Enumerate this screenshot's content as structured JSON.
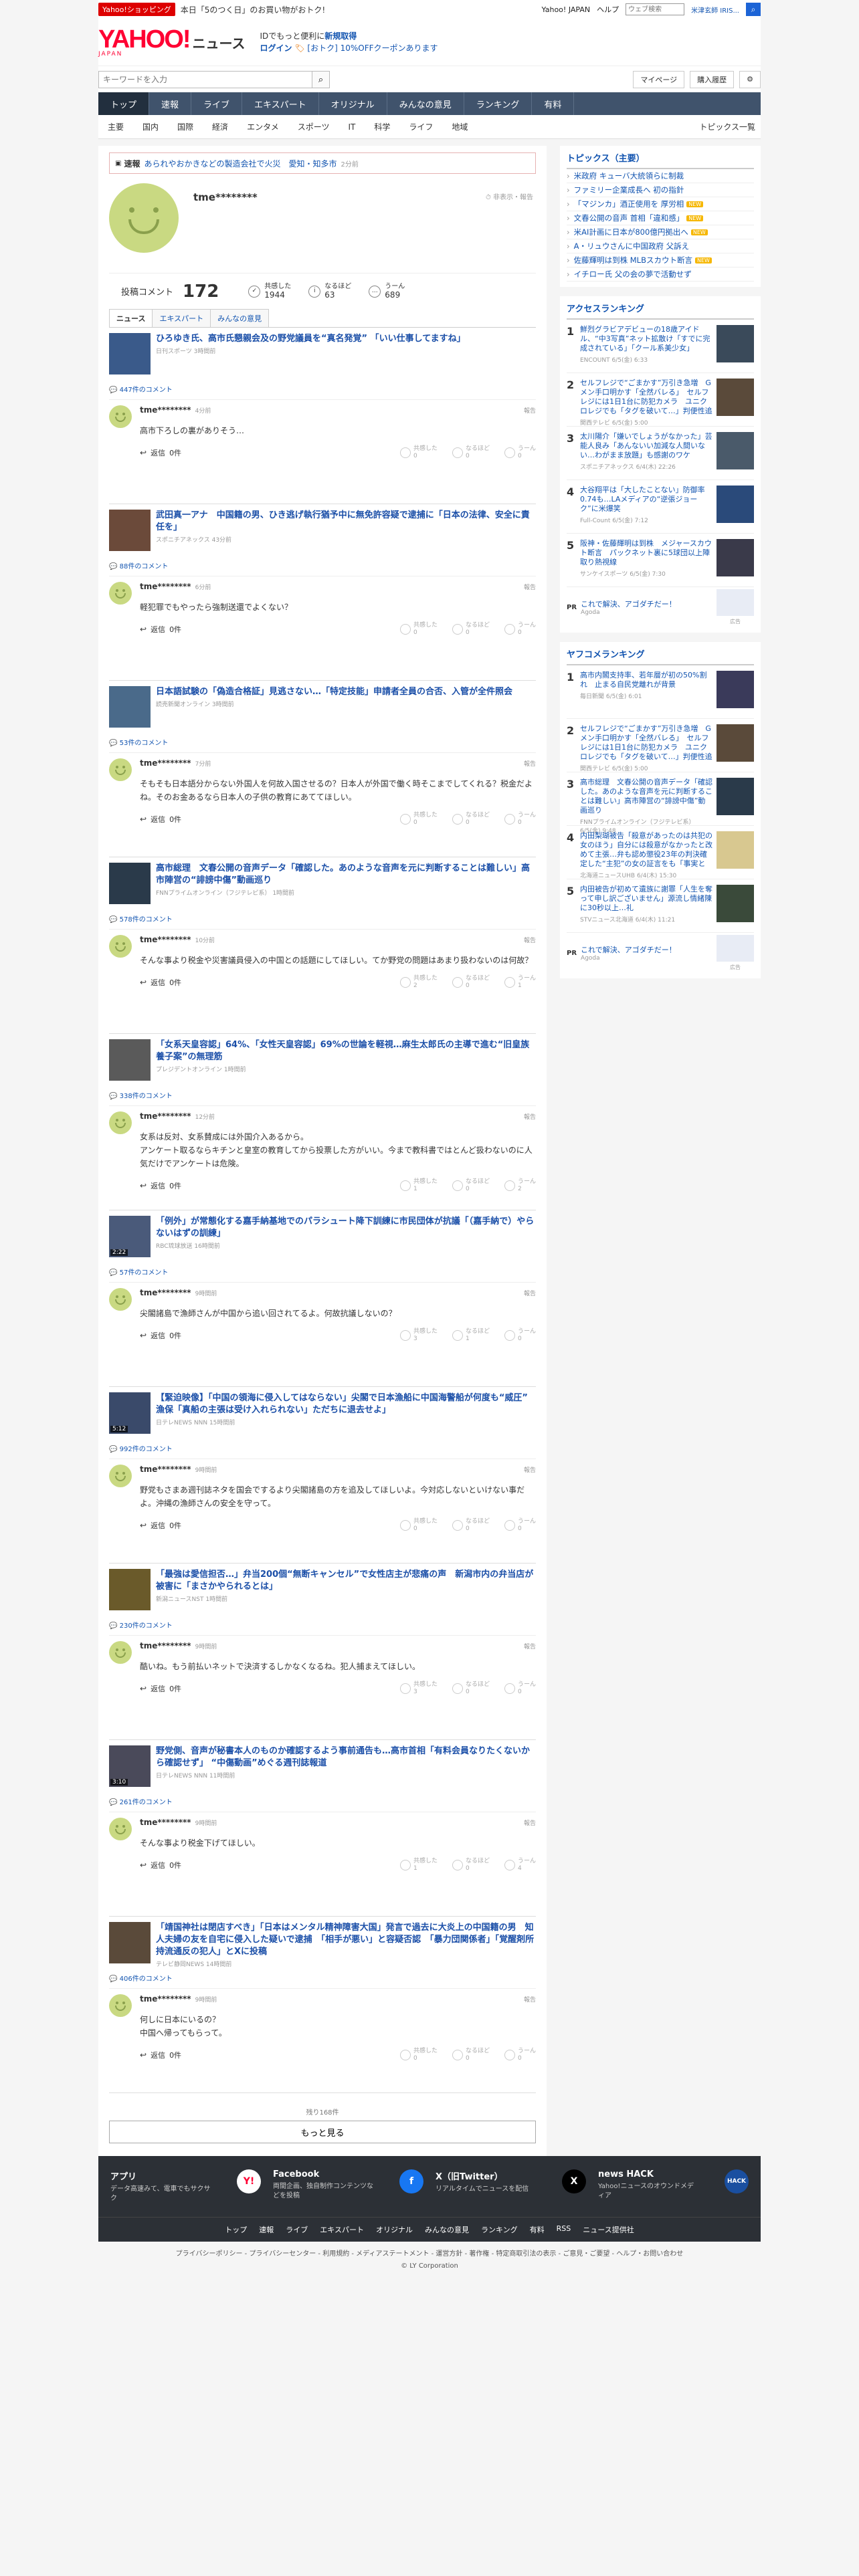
{
  "topstrip": {
    "shop_badge": "Yahoo!ショッピング",
    "promo": "本日「5のつく日」のお買い物がおトク!",
    "links": [
      "Yahoo! JAPAN",
      "ヘルプ"
    ],
    "search_placeholder": "ウェブ検索",
    "search_tip": "米津玄師 IRIS..."
  },
  "header": {
    "logo": "YAHOO!",
    "logo_sub": "JAPAN",
    "service": "ニュース",
    "promo_line1_a": "IDでもっと便利に",
    "promo_line1_b": "新規取得",
    "promo_line2_a": "ログイン",
    "promo_line2_b": "[おトク] 10%OFFクーポンあります"
  },
  "search": {
    "placeholder": "キーワードを入力",
    "mypage": "マイページ",
    "history": "購入履歴"
  },
  "nav": [
    "トップ",
    "速報",
    "ライブ",
    "エキスパート",
    "オリジナル",
    "みんなの意見",
    "ランキング",
    "有料"
  ],
  "subnav": [
    "主要",
    "国内",
    "国際",
    "経済",
    "エンタメ",
    "スポーツ",
    "IT",
    "科学",
    "ライフ",
    "地域"
  ],
  "subnav_right": "トピックス一覧",
  "breaking": {
    "tag": "速報",
    "title": "あられやおかきなどの製造会社で火災　愛知・知多市",
    "meta": "2分前"
  },
  "profile": {
    "username": "tme********",
    "report": "非表示・報告",
    "post_label": "投稿コメント",
    "post_count": "172",
    "reacts": [
      {
        "icon": "✓",
        "label": "共感した",
        "value": "1944"
      },
      {
        "icon": "i",
        "label": "なるほど",
        "value": "63"
      },
      {
        "icon": "…",
        "label": "うーん",
        "value": "689"
      }
    ]
  },
  "tabs": [
    "ニュース",
    "エキスパート",
    "みんなの意見"
  ],
  "comment_labels": {
    "reply": "返信",
    "reply_count": "0件",
    "report": "報告",
    "agree": "共感した",
    "naruhodo": "なるほど",
    "uun": "うーん"
  },
  "entries": [
    {
      "title": "ひろゆき氏、高市氏懇親会及の野党議員を“真名発覚” 「いい仕事してますね」",
      "source": "日刊スポーツ 3時間前",
      "video": "",
      "count": "447件のコメント",
      "user": "tme********",
      "time": "4分前",
      "text": "高市下ろしの裏がありそう…",
      "r": [
        "0",
        "0",
        "0"
      ],
      "thumb": "#3a5a8a"
    },
    {
      "title": "武田真一アナ　中国籍の男、ひき逃げ執行猶予中に無免許容疑で逮捕に「日本の法律、安全に責任を」",
      "source": "スポニチアネックス 43分前",
      "video": "",
      "count": "88件のコメント",
      "user": "tme********",
      "time": "6分前",
      "text": "軽犯罪でもやったら強制送還でよくない？",
      "r": [
        "0",
        "0",
        "0"
      ],
      "thumb": "#6b4a3a"
    },
    {
      "title": "日本語試験の「偽造合格証」見逃さない…「特定技能」申請者全員の合否、入管が全件照会",
      "source": "読売新聞オンライン 3時間前",
      "video": "",
      "count": "53件のコメント",
      "user": "tme********",
      "time": "7分前",
      "text": "そもそも日本語分からない外国人を何故入国させるの？日本人が外国で働く時そこまでしてくれる？税金だよね。そのお金あるなら日本人の子供の教育にあててほしい。",
      "r": [
        "0",
        "0",
        "0"
      ],
      "thumb": "#4a6a8a"
    },
    {
      "title": "高市総理　文春公開の音声データ「確認した。あのような音声を元に判断することは難しい」高市陣営の“誹謗中傷”動画巡り",
      "source": "FNNプライムオンライン（フジテレビ系） 1時間前",
      "video": "",
      "count": "578件のコメント",
      "user": "tme********",
      "time": "10分前",
      "text": "そんな事より税金や災害議員侵入の中国との話題にしてほしい。てか野党の問題はあまり扱わないのは何故？",
      "r": [
        "2",
        "0",
        "1"
      ],
      "thumb": "#2a3a4a"
    },
    {
      "title": "「女系天皇容認」64%、「女性天皇容認」69%の世論を軽視…麻生太郎氏の主導で進む“旧皇族養子案”の無理筋",
      "source": "プレジデントオンライン 1時間前",
      "video": "",
      "count": "338件のコメント",
      "user": "tme********",
      "time": "12分前",
      "text": "女系は反対、女系賛成には外国介入あるから。\nアンケート取るならキチンと皇室の教育してから投票した方がいい。今まで教科書ではとんど扱わないのに人気だけでアンケートは危険。",
      "r": [
        "1",
        "0",
        "2"
      ],
      "thumb": "#5a5a5a"
    },
    {
      "title": "「例外」が常態化する嘉手納基地でのパラシュート降下訓練に市民団体が抗議「（嘉手納で）やらないはずの訓練」",
      "source": "RBC琉球放送 16時間前",
      "video": "2:22",
      "count": "57件のコメント",
      "user": "tme********",
      "time": "9時間前",
      "text": "尖閣諸島で漁師さんが中国から追い回されてるよ。何故抗議しないの？",
      "r": [
        "3",
        "1",
        "0"
      ],
      "thumb": "#4a5a7a"
    },
    {
      "title": "【緊迫映像】「中国の領海に侵入してはならない」尖閣で日本漁船に中国海警船が何度も“威圧”　漁保「真船の主張は受け入れられない」ただちに退去せよ」",
      "source": "日テレNEWS NNN 15時間前",
      "video": "5:12",
      "count": "992件のコメント",
      "user": "tme********",
      "time": "9時間前",
      "text": "野党もさまあ週刊誌ネタを国会でするより尖閣諸島の方を追及してほしいよ。今対応しないといけない事だよ。沖縄の漁師さんの安全を守って。",
      "r": [
        "0",
        "0",
        "0"
      ],
      "thumb": "#3a4a6a"
    },
    {
      "title": "「最強は愛信担否…」弁当200個“無断キャンセル”で女性店主が悲痛の声　新潟市内の弁当店が被害に「まさかやられるとは」",
      "source": "新潟ニュースNST 1時間前",
      "video": "",
      "count": "230件のコメント",
      "user": "tme********",
      "time": "9時間前",
      "text": "酷いね。もう前払いネットで決済するしかなくなるね。犯人捕まえてほしい。",
      "r": [
        "3",
        "0",
        "0"
      ],
      "thumb": "#6a5a2a"
    },
    {
      "title": "野党側、音声が秘書本人のものか確認するよう事前通告も…高市首相「有料会員なりたくないから確認せず」 “中傷動画”めぐる週刊誌報道",
      "source": "日テレNEWS NNN 11時間前",
      "video": "3:10",
      "count": "261件のコメント",
      "user": "tme********",
      "time": "9時間前",
      "text": "そんな事より税金下げてほしい。",
      "r": [
        "1",
        "0",
        "4"
      ],
      "thumb": "#4a4a5a"
    },
    {
      "title": "「靖国神社は閉店すべき」「日本はメンタル精神障害大国」発言で過去に大炎上の中国籍の男　知人夫婦の友を自宅に侵入した疑いで逮捕　「相手が悪い」と容疑否認　「暴力団関係者」「覚醒剤所持流通反の犯人」とXに投稿",
      "source": "テレビ静岡NEWS 14時間前",
      "video": "",
      "count": "406件のコメント",
      "user": "tme********",
      "time": "9時間前",
      "text": "何しに日本にいるの？\n中国へ帰ってもらって。",
      "r": [
        "0",
        "0",
        "0"
      ],
      "thumb": "#5a4a3a"
    }
  ],
  "remaining": "残り168件",
  "more": "もっと見る",
  "topics": {
    "title": "トピックス（主要）",
    "new_badge": "NEW",
    "items": [
      {
        "text": "米政府 キューバ大統領らに制裁",
        "isnew": false
      },
      {
        "text": "ファミリー企業成長へ 初の指針",
        "isnew": false
      },
      {
        "text": "「マジンカ」酒正使用を 厚労相",
        "isnew": true
      },
      {
        "text": "文春公開の音声 首相「違和感」",
        "isnew": true
      },
      {
        "text": "米AI計画に日本が800億円拠出へ",
        "isnew": true
      },
      {
        "text": "A・リュウさんに中国政府 父訴え",
        "isnew": false
      },
      {
        "text": "佐藤輝明は到株 MLBスカウト断言",
        "isnew": true
      },
      {
        "text": "イチロー氏 父の会の夢で活動せず",
        "isnew": false
      }
    ]
  },
  "access_ranking": {
    "title": "アクセスランキング",
    "items": [
      {
        "no": "1",
        "title": "鮮烈グラビアデビューの18歳アイドル、“中3写真”ネット拡散け「すでに完成されている」「クール系美少女」",
        "src": "ENCOUNT 6/5(金) 6:33",
        "thumb": "#3a4a5a"
      },
      {
        "no": "2",
        "title": "セルフレジで“ごまかす”万引き急増　G メン手口明かす「全然バレる」　セルフレジには1日1台に防犯カメラ　ユニクロレジでも「タグを破いて…」判便性追求に一番の対策は原点回帰「手厚い接客」",
        "src": "関西テレビ 6/5(金) 5:00",
        "thumb": "#5a4a3a"
      },
      {
        "no": "3",
        "title": "太川陽介「嫌いでしょうがなかった」芸能人良み「あんないい加減な人間いない…わがまま放題」も感謝のワケ",
        "src": "スポニチアネックス 6/4(木) 22:26",
        "thumb": "#4a5a6a"
      },
      {
        "no": "4",
        "title": "大谷翔平は「大したことない」防御率0.74も…LAメディアの“逆張ジョーク”に米爆笑",
        "src": "Full-Count 6/5(金) 7:12",
        "thumb": "#2a4a7a"
      },
      {
        "no": "5",
        "title": "阪神・佐藤輝明は到株　メジャースカウト断言　パックネット裏に5球団以上陣取り熱視線",
        "src": "サンケイスポーツ 6/5(金) 7:30",
        "thumb": "#3a3a4a"
      }
    ]
  },
  "pr": {
    "tag": "PR",
    "text": "これで解決、アゴダチだー！",
    "src": "Agoda",
    "ad": "広告"
  },
  "yafuko_ranking": {
    "title": "ヤフコメランキング",
    "items": [
      {
        "no": "1",
        "title": "高市内閣支持率、若年層が初の50%割れ　止まる自民党離れが背景",
        "src": "毎日新聞 6/5(金) 6:01",
        "thumb": "#3a3a5a"
      },
      {
        "no": "2",
        "title": "セルフレジで“ごまかす”万引き急増　G メン手口明かす「全然バレる」　セルフレジには1日1台に防犯カメラ　ユニクロレジでも「タグを破いて…」判便性追求に一番の対策は原点回帰「手厚い接客」",
        "src": "関西テレビ 6/5(金) 5:00",
        "thumb": "#5a4a3a"
      },
      {
        "no": "3",
        "title": "高市総理　文春公開の音声データ「確認した。あのような音声を元に判断することは難しい」高市陣営の“誹謗中傷”動画巡り",
        "src": "FNNプライムオンライン（フジテレビ系） 6/5(金) 9:48",
        "thumb": "#2a3a4a"
      },
      {
        "no": "4",
        "title": "内田梨瑚被告「殺意があったのは共犯の女のほう」自分には殺意がなかったと改めて主張…弁も認め懲役23年の判決確定した“主犯”の女の証言をも「事実と違う」と否定＜旭川女子高校生殺害＞",
        "src": "北海道ニュースUHB 6/4(木) 15:30",
        "thumb": "#d8c890"
      },
      {
        "no": "5",
        "title": "内田被告が初めて遺族に謝罪「人生を奪って申し訳ございません」源流し情緒陳に30秒以上…礼",
        "src": "STVニュース北海道 6/4(木) 11:21",
        "thumb": "#3a4a3a"
      }
    ]
  },
  "footer": {
    "apps": [
      {
        "name": "アプリ",
        "desc": "データ高速みて、電車でもサクサク",
        "icon": "app-icon",
        "color": "#ffffff",
        "glyph": "Y!"
      },
      {
        "name": "Facebook",
        "desc": "両間企画、独自制作コンテンツなどを投稿",
        "icon": "facebook-icon",
        "color": "#1877f2",
        "glyph": "f"
      },
      {
        "name": "X（旧Twitter）",
        "desc": "リアルタイムでニュースを配信",
        "icon": "x-icon",
        "color": "#000000",
        "glyph": "X"
      },
      {
        "name": "news HACK",
        "desc": "Yahoo!ニュースのオウンドメディア",
        "icon": "newshack-icon",
        "color": "#1a4fa0",
        "glyph": "HACK"
      }
    ],
    "links": [
      "トップ",
      "速報",
      "ライブ",
      "エキスパート",
      "オリジナル",
      "みんなの意見",
      "ランキング",
      "有料",
      "RSS",
      "ニュース提供社"
    ],
    "legal": "プライバシーポリシー - プライバシーセンター - 利用規約 - メディアステートメント - 運営方針 - 著作権 - 特定商取引法の表示 - ご意見・ご要望 - ヘルプ・お問い合わせ",
    "copyright": "© LY Corporation"
  }
}
